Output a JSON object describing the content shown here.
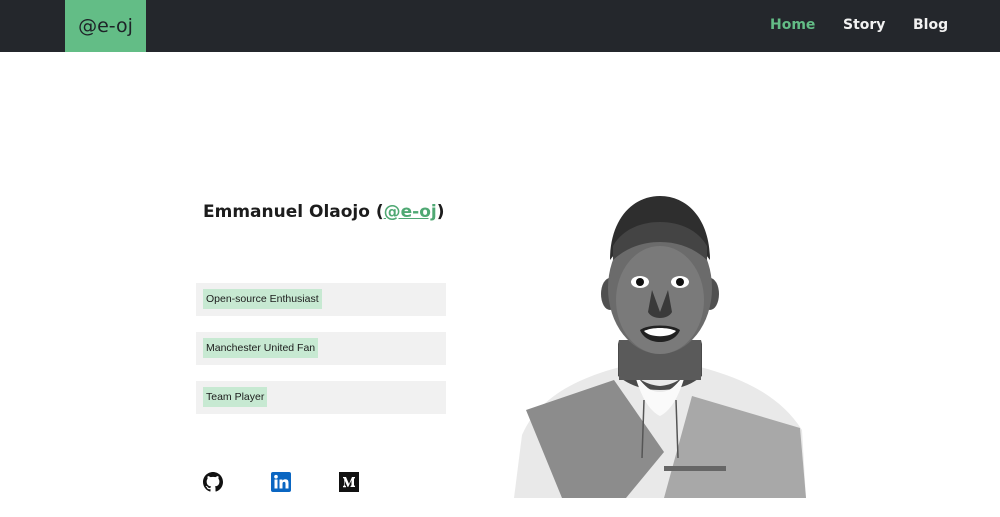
{
  "header": {
    "logo": "@e-oj",
    "nav": [
      {
        "label": "Home",
        "active": true
      },
      {
        "label": "Story",
        "active": false
      },
      {
        "label": "Blog",
        "active": false
      }
    ]
  },
  "profile": {
    "name": "Emmanuel Olaojo",
    "open_paren": "(",
    "handle": "@e-oj",
    "close_paren": ")"
  },
  "tags": [
    "Open-source Enthusiast",
    "Manchester United Fan",
    "Team Player"
  ],
  "social": [
    "github-icon",
    "linkedin-icon",
    "medium-icon"
  ],
  "colors": {
    "nav_background": "#24272c",
    "accent": "#63bd86",
    "link": "#4fa873",
    "tag_highlight": "#c7e9d2",
    "tag_box": "#f1f1f1"
  }
}
